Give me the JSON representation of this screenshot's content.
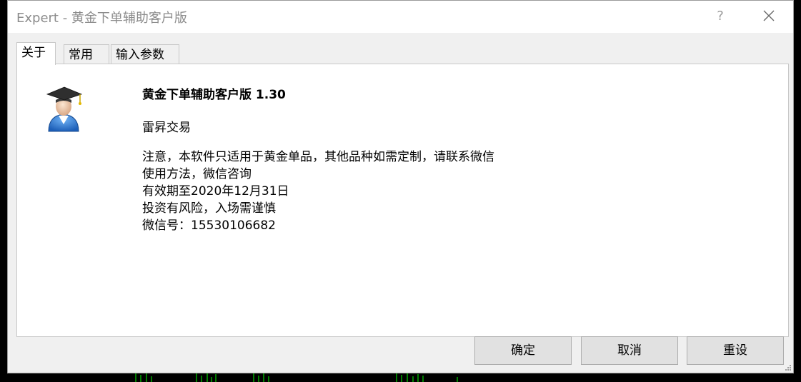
{
  "window": {
    "title": "Expert - 黄金下单辅助客户版",
    "help_glyph": "?"
  },
  "tabs": [
    {
      "label": "关于"
    },
    {
      "label": "常用"
    },
    {
      "label": "输入参数"
    }
  ],
  "about": {
    "icon": "graduate-user-icon",
    "app_name": "黄金下单辅助客户版 1.30",
    "author": "雷昇交易",
    "lines": [
      "注意，本软件只适用于黄金单品，其他品种如需定制，请联系微信",
      "使用方法，微信咨询",
      "有效期至2020年12月31日",
      "投资有风险，入场需谨慎",
      "微信号：15530106682"
    ]
  },
  "buttons": {
    "ok": "确定",
    "cancel": "取消",
    "reset": "重设"
  },
  "colors": {
    "background_chart": "#000000",
    "chart_bars": "#00ff00",
    "dialog_bg": "#f0f0f0",
    "title_text": "#8c8c8c"
  }
}
